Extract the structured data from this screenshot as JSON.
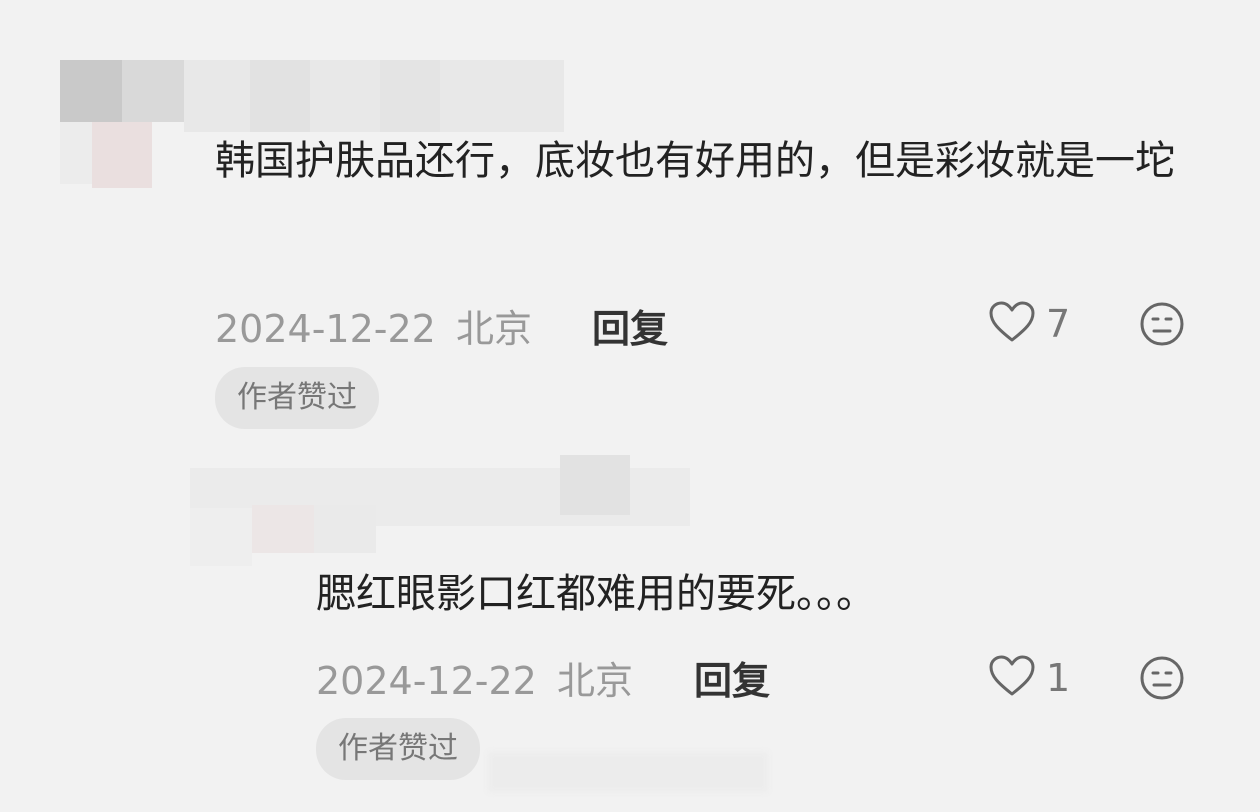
{
  "comments": [
    {
      "text": "韩国护肤品还行，底妆也有好用的，但是彩妆就是一坨",
      "date": "2024-12-22",
      "location": "北京",
      "reply_label": "回复",
      "likes": "7",
      "badge": "作者赞过"
    },
    {
      "text": "腮红眼影口红都难用的要死。。。",
      "date": "2024-12-22",
      "location": "北京",
      "reply_label": "回复",
      "likes": "1",
      "badge": "作者赞过"
    }
  ],
  "icons": {
    "like": "heart-outline-icon",
    "dislike": "meh-face-icon"
  },
  "colors": {
    "background": "#f2f2f2",
    "text": "#222222",
    "meta": "#999999",
    "badge_bg": "#e4e4e4"
  }
}
